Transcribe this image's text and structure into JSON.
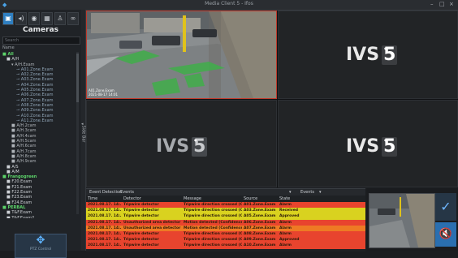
{
  "window": {
    "title": "Media Client 5 - Ifos",
    "controls": [
      "–",
      "□",
      "×"
    ]
  },
  "sidebar": {
    "toolbar": [
      "camera-icon",
      "audio-icon",
      "eye-icon",
      "layout-icon",
      "users-icon",
      "link-icon"
    ],
    "title": "Cameras",
    "search_placeholder": "Search",
    "tree_header": "Name",
    "tree": [
      {
        "level": "g",
        "label": "■ All"
      },
      {
        "level": "l1",
        "label": "■ A/H"
      },
      {
        "level": "l2",
        "label": "▾ A/H.Exam"
      },
      {
        "level": "l3",
        "label": "⊸ A01.Zone.Exam"
      },
      {
        "level": "l3",
        "label": "⊸ A02.Zone.Exam"
      },
      {
        "level": "l3",
        "label": "⊸ A03.Zone.Exam"
      },
      {
        "level": "l3",
        "label": "⊸ A04.Zone.Exam"
      },
      {
        "level": "l3",
        "label": "⊸ A05.Zone.Exam"
      },
      {
        "level": "l3",
        "label": "⊸ A06.Zone.Exam"
      },
      {
        "level": "l3",
        "label": "⊸ A07.Zone.Exam"
      },
      {
        "level": "l3",
        "label": "⊸ A08.Zone.Exam"
      },
      {
        "level": "l3",
        "label": "⊸ A09.Zone.Exam"
      },
      {
        "level": "l3",
        "label": "⊸ A10.Zone.Exam"
      },
      {
        "level": "l3",
        "label": "⊸ A11.Zone.Exam"
      },
      {
        "level": "l2",
        "label": "■ A/H.2cam"
      },
      {
        "level": "l2",
        "label": "■ A/H.3cam"
      },
      {
        "level": "l2",
        "label": "■ A/H.4cam"
      },
      {
        "level": "l2",
        "label": "■ A/H.5cam"
      },
      {
        "level": "l2",
        "label": "■ A/H.6cam"
      },
      {
        "level": "l2",
        "label": "■ A/H.7cam"
      },
      {
        "level": "l2",
        "label": "■ A/H.8cam"
      },
      {
        "level": "l2",
        "label": "■ A/H.9cam"
      },
      {
        "level": "l1",
        "label": "■ A/S"
      },
      {
        "level": "l1",
        "label": "■ A/M"
      },
      {
        "level": "g",
        "label": "■ Frangogreen"
      },
      {
        "level": "l1",
        "label": "■ F20.Exam"
      },
      {
        "level": "l1",
        "label": "■ F21.Exam"
      },
      {
        "level": "l1",
        "label": "■ F22.Exam"
      },
      {
        "level": "l1",
        "label": "■ F23.Exam"
      },
      {
        "level": "l1",
        "label": "■ F24.Exam"
      },
      {
        "level": "g",
        "label": "■ PERBAL"
      },
      {
        "level": "l1",
        "label": "■ T&F.Exam"
      },
      {
        "level": "l1",
        "label": "■ T&F.Exam2"
      }
    ],
    "ptz_label": "PTZ Control"
  },
  "side_panel": {
    "label": "Side Bar"
  },
  "grid": {
    "logo_text": "IVS",
    "logo_number": "5",
    "camera_label_line1": "A01.Zone.Exam",
    "camera_label_line2": "2021-08-17 14:01"
  },
  "events": {
    "tabs": [
      "Event Detection",
      "Events"
    ],
    "filter_label": "Events",
    "columns": [
      "Time",
      "Detector",
      "Message",
      "Source",
      "State"
    ],
    "rows": [
      {
        "time": "2021.08.17. 14:...",
        "detector": "Tripwire detector",
        "message": "Tripwire direction crossed (Con...",
        "source": "A01.Zone.Exam",
        "state": "Alarm",
        "color": "red"
      },
      {
        "time": "2021.08.17. 14:...",
        "detector": "Tripwire detector",
        "message": "Tripwire direction crossed (Con...",
        "source": "A03.Zone.Exam",
        "state": "Received",
        "color": "yellow"
      },
      {
        "time": "2021.08.17. 14:...",
        "detector": "Tripwire detector",
        "message": "Tripwire direction crossed (Con...",
        "source": "A05.Zone.Exam",
        "state": "Approved",
        "color": "yellow"
      },
      {
        "time": "2021.08.17. 14:...",
        "detector": "Unauthorized area detector",
        "message": "Motion detected (Confidence: 0...",
        "source": "A06.Zone.Exam",
        "state": "Alarm",
        "color": "red"
      },
      {
        "time": "2021.08.17. 14:...",
        "detector": "Unauthorized area detector",
        "message": "Motion detected (Confidence: 0...",
        "source": "A07.Zone.Exam",
        "state": "Alarm",
        "color": "orange"
      },
      {
        "time": "2021.08.17. 14:...",
        "detector": "Tripwire detector",
        "message": "Tripwire direction crossed (Con...",
        "source": "A08.Zone.Exam",
        "state": "Alarm",
        "color": "red"
      },
      {
        "time": "2021.08.17. 14:...",
        "detector": "Tripwire detector",
        "message": "Tripwire direction crossed (Con...",
        "source": "A09.Zone.Exam",
        "state": "Approved",
        "color": "red"
      },
      {
        "time": "2021.08.17. 14:...",
        "detector": "Tripwire detector",
        "message": "Tripwire direction crossed (Con...",
        "source": "A10.Zone.Exam",
        "state": "Alarm",
        "color": "red"
      }
    ]
  },
  "preview": {
    "ack_icon": "check-icon",
    "mute_icon": "mute-icon"
  },
  "colors": {
    "accent": "#2f7fc1",
    "alarm_red": "#e8442e",
    "alarm_yellow": "#d9d21f",
    "alarm_orange": "#ee7a24",
    "selected_border": "#c0392b"
  }
}
